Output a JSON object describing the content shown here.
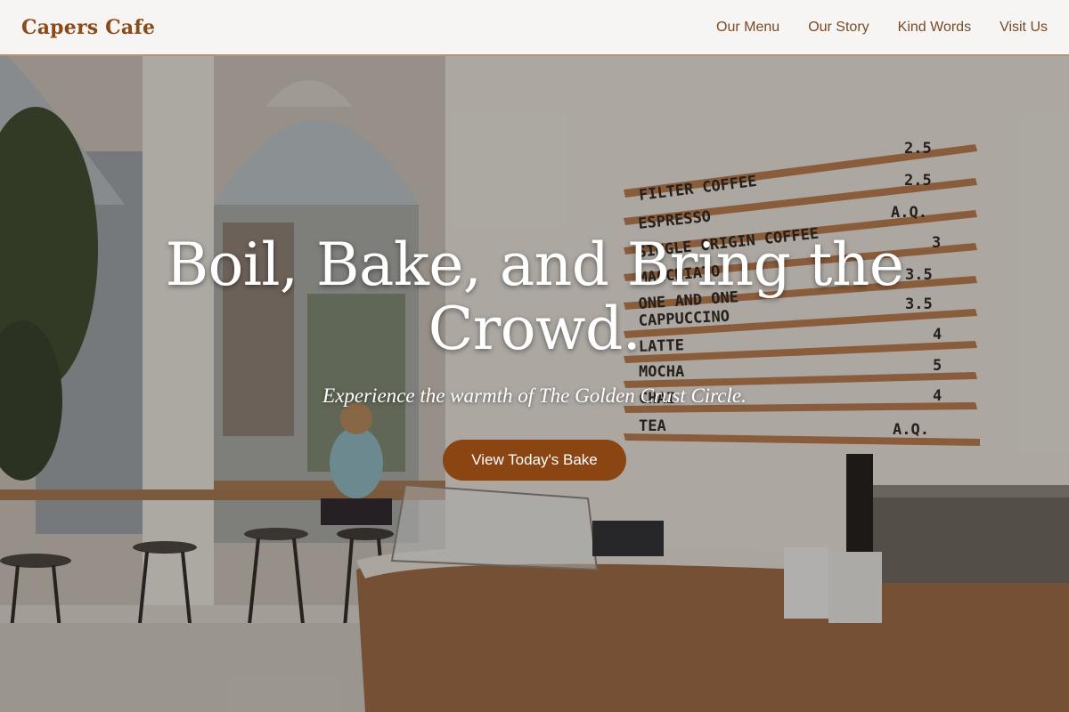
{
  "brand": {
    "name": "Capers Cafe"
  },
  "nav": {
    "items": [
      {
        "label": "Our Menu"
      },
      {
        "label": "Our Story"
      },
      {
        "label": "Kind Words"
      },
      {
        "label": "Visit Us"
      }
    ]
  },
  "hero": {
    "headline": "Boil, Bake, and Bring the Crowd.",
    "tagline": "Experience the warmth of The Golden Crust Circle.",
    "cta_label": "View Today's Bake"
  },
  "menu_board": {
    "items": [
      {
        "name": "FILTER COFFEE",
        "price": "2.5"
      },
      {
        "name": "ESPRESSO",
        "price": "2.5"
      },
      {
        "name": "SINGLE ORIGIN COFFEE",
        "price": "A.Q."
      },
      {
        "name": "MACCHIATO",
        "price": "3"
      },
      {
        "name": "ONE AND ONE",
        "price": "3.5"
      },
      {
        "name": "CAPPUCCINO",
        "price": "3.5"
      },
      {
        "name": "LATTE",
        "price": "4"
      },
      {
        "name": "MOCHA",
        "price": "5"
      },
      {
        "name": "CHAI",
        "price": "4"
      },
      {
        "name": "TEA",
        "price": "A.Q."
      }
    ]
  },
  "colors": {
    "accent": "#8b4513",
    "nav_text": "#7c4a25",
    "brand": "#8b4a1a"
  }
}
